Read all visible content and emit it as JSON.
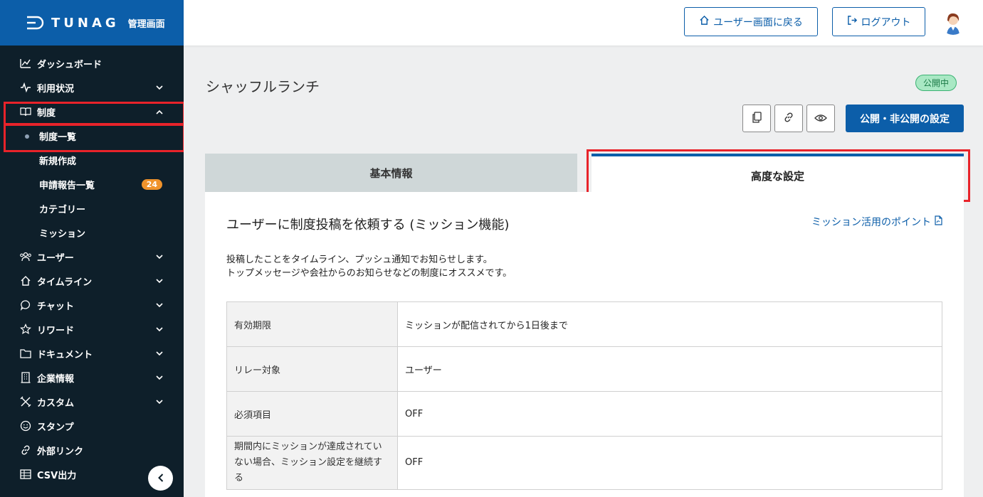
{
  "brand": {
    "logo_text": "TUNAG",
    "subtitle": "管理画面"
  },
  "sidebar": {
    "items": [
      {
        "label": "ダッシュボード"
      },
      {
        "label": "利用状況"
      },
      {
        "label": "制度"
      },
      {
        "label": "ユーザー"
      },
      {
        "label": "タイムライン"
      },
      {
        "label": "チャット"
      },
      {
        "label": "リワード"
      },
      {
        "label": "ドキュメント"
      },
      {
        "label": "企業情報"
      },
      {
        "label": "カスタム"
      },
      {
        "label": "スタンプ"
      },
      {
        "label": "外部リンク"
      },
      {
        "label": "CSV出力"
      }
    ],
    "subitems": [
      {
        "label": "制度一覧"
      },
      {
        "label": "新規作成"
      },
      {
        "label": "申請報告一覧",
        "badge": "24"
      },
      {
        "label": "カテゴリー"
      },
      {
        "label": "ミッション"
      }
    ]
  },
  "header": {
    "user_screen_label": "ユーザー画面に戻る",
    "logout_label": "ログアウト"
  },
  "page": {
    "title": "シャッフルランチ",
    "status": "公開中",
    "publish_button": "公開・非公開の設定",
    "tabs": [
      {
        "label": "基本情報"
      },
      {
        "label": "高度な設定"
      }
    ]
  },
  "section": {
    "title": "ユーザーに制度投稿を依頼する (ミッション機能)",
    "help_link": "ミッション活用のポイント",
    "desc_line1": "投稿したことをタイムライン、プッシュ通知でお知らせします。",
    "desc_line2": "トップメッセージや会社からのお知らせなどの制度にオススメです。",
    "rows": [
      {
        "key": "有効期限",
        "value": "ミッションが配信されてから1日後まで"
      },
      {
        "key": "リレー対象",
        "value": "ユーザー"
      },
      {
        "key": "必須項目",
        "value": "OFF"
      },
      {
        "key": "期間内にミッションが達成されていない場合、ミッション設定を継続する",
        "value": "OFF"
      }
    ]
  },
  "colors": {
    "brand_blue": "#0c5ea9",
    "sidebar_bg": "#0e1f2a",
    "highlight_red": "#e8232a",
    "badge_orange": "#f0932b"
  }
}
